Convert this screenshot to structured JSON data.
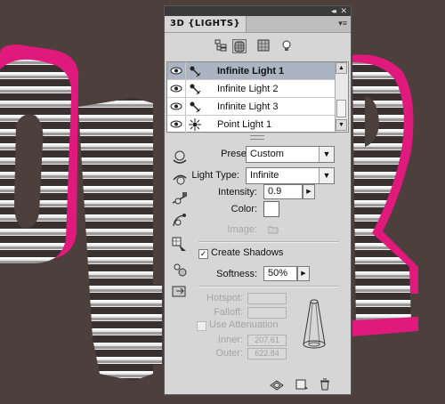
{
  "panel": {
    "tab_title": "3D {LIGHTS}",
    "collapse_glyph": "◂◂",
    "close_glyph": "✕",
    "menu_glyph": "▾≡",
    "filter_buttons": [
      "scene-filter-icon",
      "mesh-filter-icon",
      "materials-filter-icon",
      "lights-filter-icon"
    ]
  },
  "lights": [
    {
      "label": "Infinite Light 1",
      "type_icon": "infinite-light-icon",
      "visible": true,
      "selected": true
    },
    {
      "label": "Infinite Light 2",
      "type_icon": "infinite-light-icon",
      "visible": true,
      "selected": false
    },
    {
      "label": "Infinite Light 3",
      "type_icon": "infinite-light-icon",
      "visible": true,
      "selected": false
    },
    {
      "label": "Point Light 1",
      "type_icon": "point-light-icon",
      "visible": true,
      "selected": false
    }
  ],
  "props": {
    "preset_label": "Preset:",
    "preset_value": "Custom",
    "light_type_label": "Light Type:",
    "light_type_value": "Infinite",
    "intensity_label": "Intensity:",
    "intensity_value": "0.9",
    "color_label": "Color:",
    "color_value": "#ffffff",
    "image_label": "Image:",
    "create_shadows_label": "Create Shadows",
    "create_shadows_checked": true,
    "softness_label": "Softness:",
    "softness_value": "50%",
    "hotspot_label": "Hotspot:",
    "falloff_label": "Falloff:",
    "use_attenuation_label": "Use Attenuation",
    "inner_label": "Inner:",
    "inner_value": "207.61",
    "outer_label": "Outer:",
    "outer_value": "622.84"
  },
  "glyphs": {
    "dropdown_arrow": "▼",
    "step_right": "▶",
    "scroll_up": "▲",
    "scroll_down": "▼",
    "check": "✓"
  },
  "tools": [
    "rotate-light-icon",
    "roll-light-icon",
    "drag-light-icon",
    "slide-light-icon",
    "scale-light-icon",
    "point-at-origin-icon",
    "move-to-view-icon"
  ],
  "bottom_tools": [
    "toggle-overlays-icon",
    "new-light-icon",
    "delete-light-icon"
  ],
  "colors": {
    "canvas_bg": "#4d403c",
    "text_outline": "#e0197d",
    "panel_bg": "#d6d6d6",
    "selection": "#aab4c3"
  }
}
